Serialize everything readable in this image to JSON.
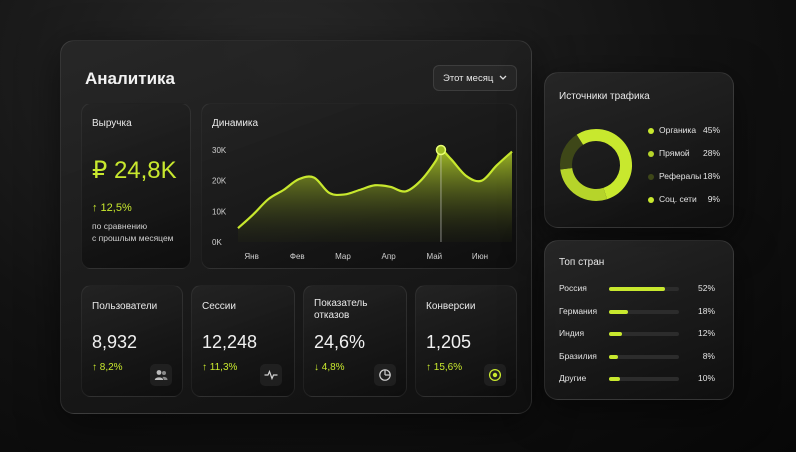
{
  "colors": {
    "accent": "#c8e82e",
    "accent_mid": "#8da41f",
    "accent_dark": "#3e4718",
    "muted_track": "#2c2c2c"
  },
  "header": {
    "title": "Аналитика",
    "period_select": "Этот месяц"
  },
  "revenue": {
    "label": "Выручка",
    "value": "₽ 24,8K",
    "delta": "↑ 12,5%",
    "note_line1": "по сравнению",
    "note_line2": "с прошлым месяцем"
  },
  "dynamics": {
    "label": "Динамика"
  },
  "chart_data": {
    "type": "area",
    "title": "Динамика",
    "categories": [
      "Янв",
      "Фев",
      "Мар",
      "Апр",
      "Май",
      "Июн"
    ],
    "y_ticks": [
      "0K",
      "10K",
      "20K",
      "30K"
    ],
    "ylim": [
      0,
      30000
    ],
    "x": [
      0.0,
      0.3,
      0.6,
      0.9,
      1.2,
      1.5,
      1.8,
      2.1,
      2.4,
      2.7,
      3.0,
      3.3,
      3.6,
      3.9,
      4.0,
      4.2,
      4.5,
      4.8,
      5.1,
      5.4
    ],
    "values": [
      4500,
      9000,
      14000,
      17000,
      20500,
      21000,
      16000,
      15500,
      17000,
      18500,
      18000,
      16500,
      20000,
      26500,
      30000,
      27000,
      21500,
      20000,
      25000,
      29500
    ],
    "highlight_category": "Май",
    "grid": false
  },
  "stats": [
    {
      "label": "Пользователи",
      "value": "8,932",
      "delta": "↑ 8,2%",
      "icon": "users-icon"
    },
    {
      "label": "Сессии",
      "value": "12,248",
      "delta": "↑ 11,3%",
      "icon": "pulse-icon"
    },
    {
      "label": "Показатель отказов",
      "label_line1": "Показатель",
      "label_line2": "отказов",
      "value": "24,6%",
      "delta": "↓ 4,8%",
      "icon": "pie-chart-icon"
    },
    {
      "label": "Конверсии",
      "value": "1,205",
      "delta": "↑ 15,6%",
      "icon": "target-icon"
    }
  ],
  "traffic": {
    "title": "Источники трафика",
    "items": [
      {
        "name": "Органика",
        "percent": "45%",
        "value": 45,
        "color": "#c8e82e"
      },
      {
        "name": "Прямой",
        "percent": "28%",
        "value": 28,
        "color": "#b6d42a"
      },
      {
        "name": "Рефералы",
        "percent": "18%",
        "value": 18,
        "color": "#3e4718"
      },
      {
        "name": "Соц. сети",
        "percent": "9%",
        "value": 9,
        "color": "#c8e82e"
      }
    ]
  },
  "countries": {
    "title": "Топ стран",
    "items": [
      {
        "name": "Россия",
        "percent": "52%",
        "value": 52
      },
      {
        "name": "Германия",
        "percent": "18%",
        "value": 18
      },
      {
        "name": "Индия",
        "percent": "12%",
        "value": 12
      },
      {
        "name": "Бразилия",
        "percent": "8%",
        "value": 8
      },
      {
        "name": "Другие",
        "percent": "10%",
        "value": 10
      }
    ]
  }
}
